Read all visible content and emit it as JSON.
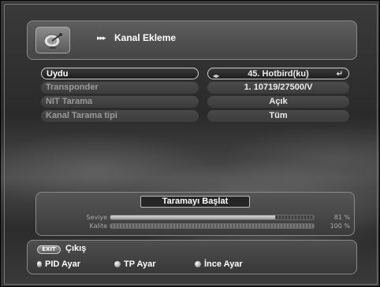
{
  "header": {
    "title": "Kanal Ekleme",
    "title_arrows": "▸▸▸",
    "logo_icon": "satellite-dish-icon"
  },
  "menu": {
    "items": [
      {
        "label": "Uydu",
        "value": "45. Hotbird(ku)",
        "selected": true
      },
      {
        "label": "Transponder",
        "value": "1. 10719/27500/V"
      },
      {
        "label": "NIT Tarama",
        "value": "Açık"
      },
      {
        "label": "Kanal Tarama tipi",
        "value": "Tüm"
      }
    ],
    "lr_icon": "◂▸",
    "enter_icon": "↵"
  },
  "scan": {
    "button_label": "Taramayı Başlat",
    "signal_level": {
      "label": "Seviye",
      "percent": "81 %",
      "fill": 0.81
    },
    "signal_quality": {
      "label": "Kalite",
      "percent": "100 %",
      "fill": 1.0
    }
  },
  "footer": {
    "exit_key": "EXIT",
    "exit_label": "Çıkış",
    "keys": [
      {
        "label": "PID Ayar"
      },
      {
        "label": "TP Ayar"
      },
      {
        "label": "İnce Ayar"
      }
    ]
  },
  "colors": {
    "background": "#2e2e2e",
    "panel": "#4a4a4a",
    "selected_border": "#cfcfcf",
    "dim_text": "#9a9a9a"
  }
}
